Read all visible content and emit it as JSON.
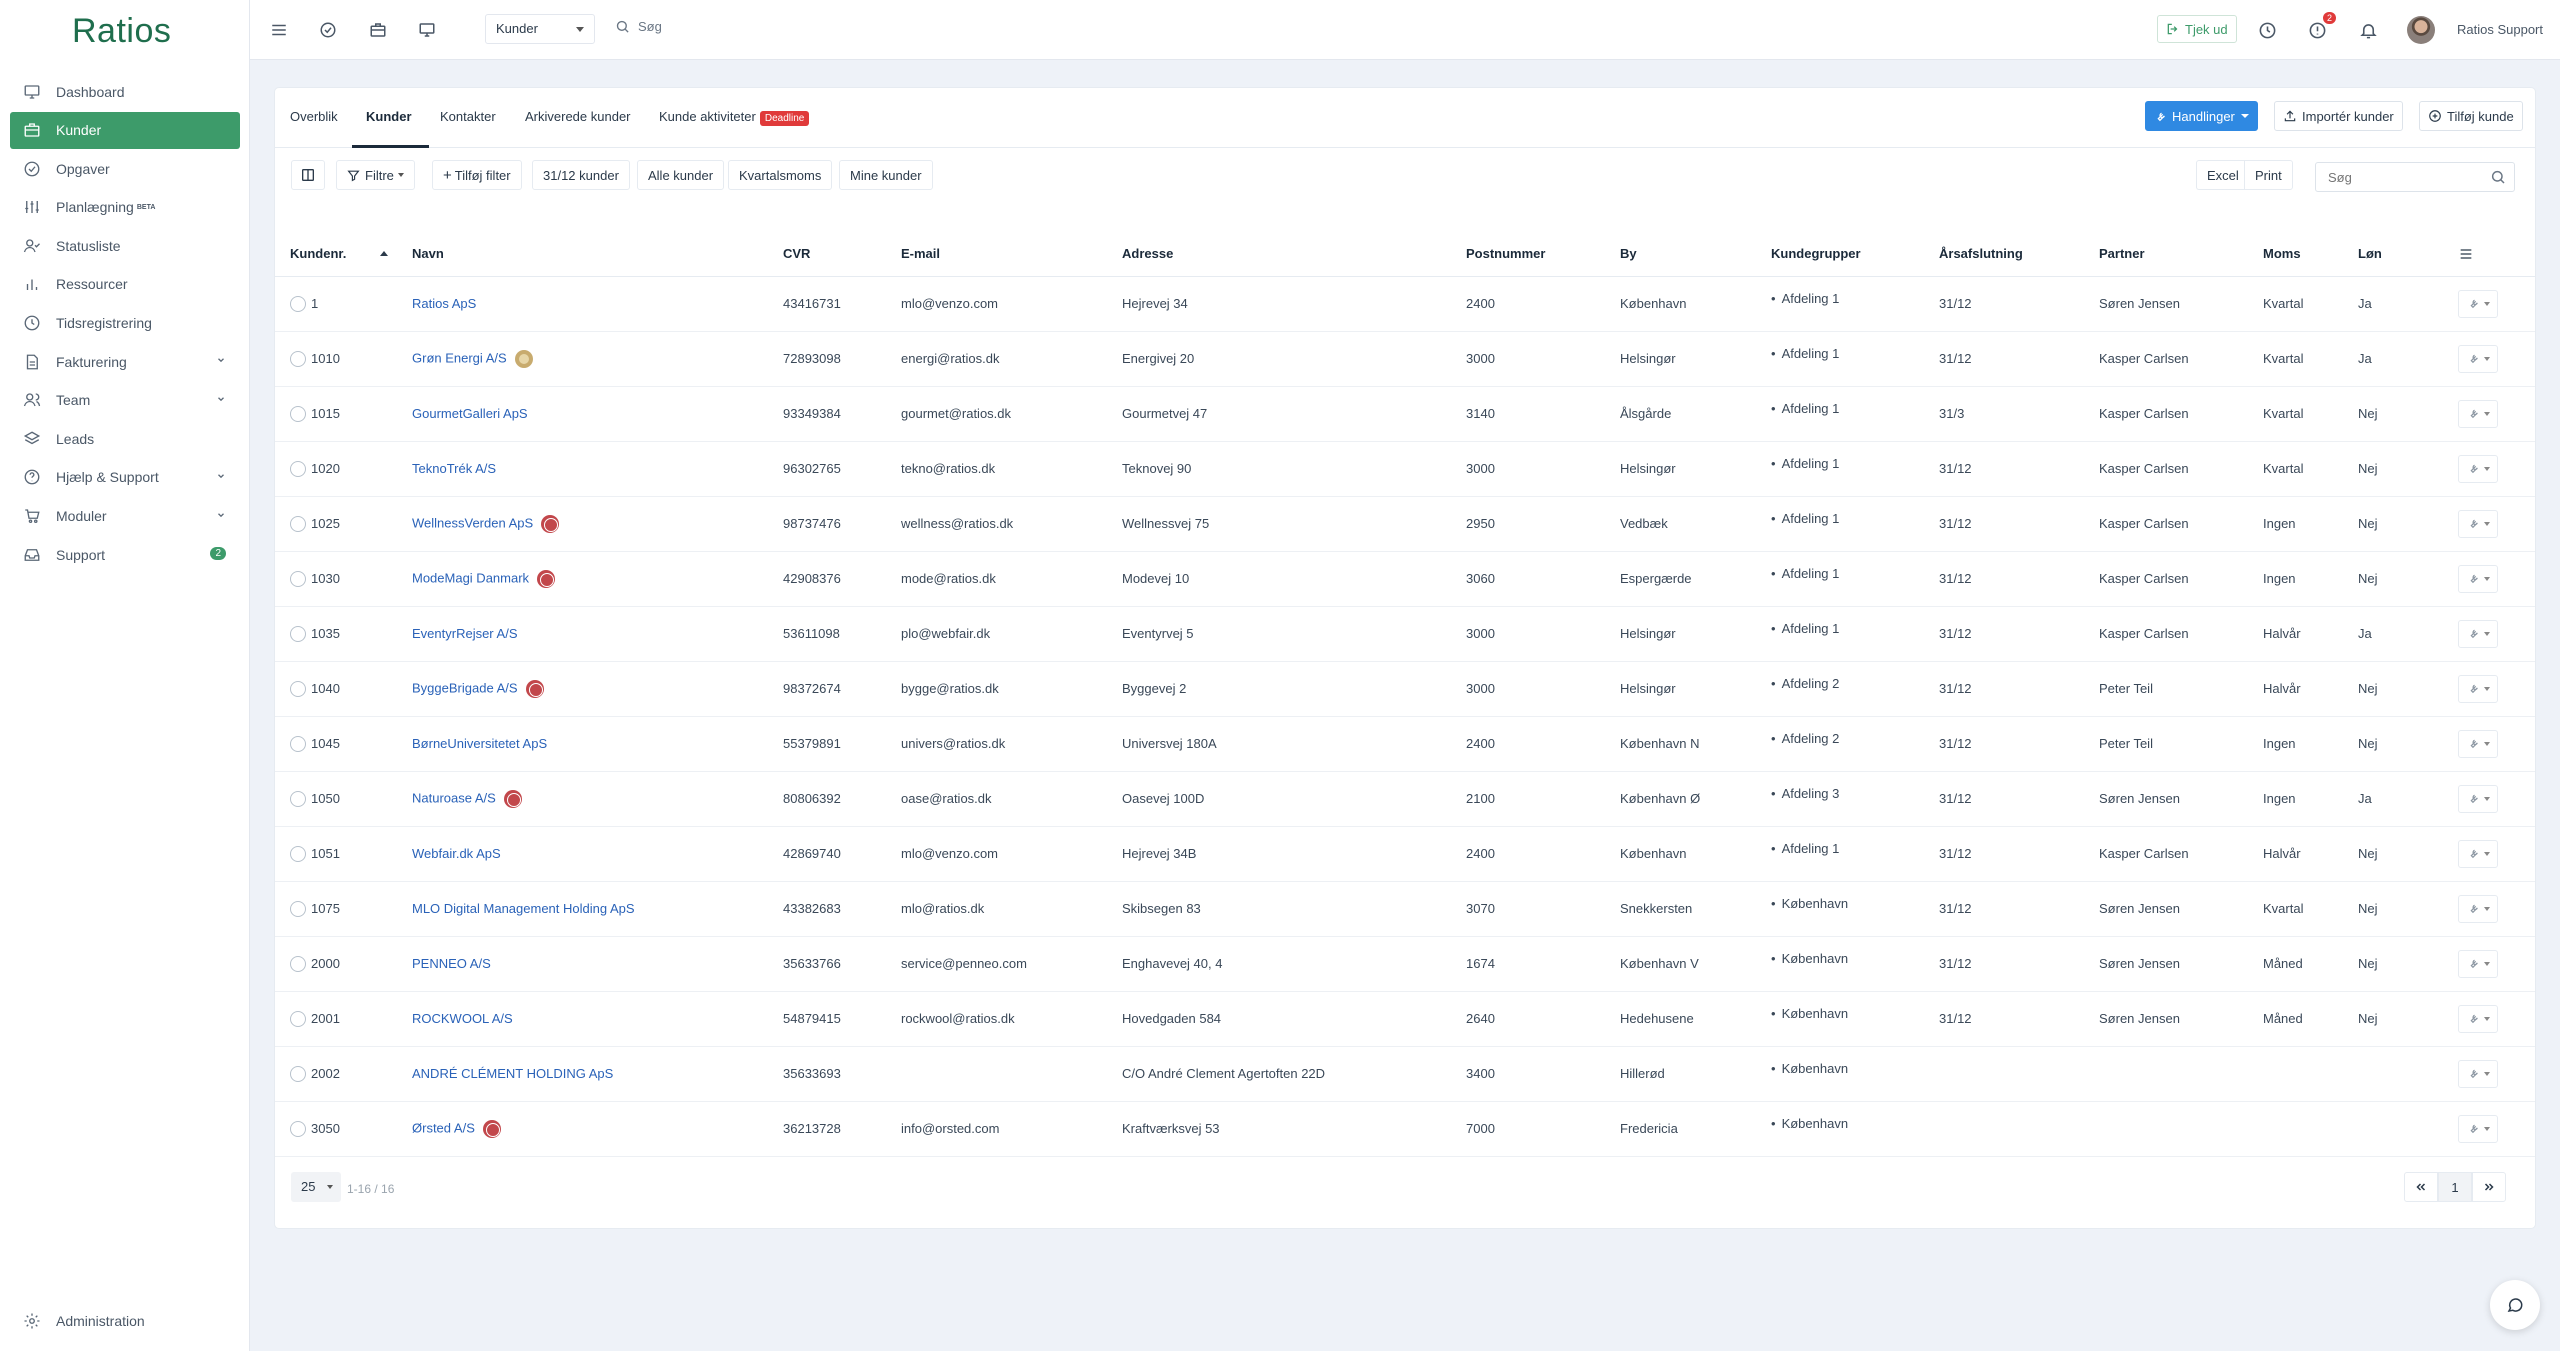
{
  "app": {
    "logo": "Ratios"
  },
  "sidebar": {
    "items": [
      {
        "label": "Dashboard",
        "icon": "monitor-icon"
      },
      {
        "label": "Kunder",
        "icon": "briefcase-icon",
        "active": true
      },
      {
        "label": "Opgaver",
        "icon": "check-circle-icon"
      },
      {
        "label": "Planlægning",
        "icon": "sliders-icon",
        "badge": "BETA"
      },
      {
        "label": "Statusliste",
        "icon": "user-check-icon"
      },
      {
        "label": "Ressourcer",
        "icon": "bar-chart-icon"
      },
      {
        "label": "Tidsregistrering",
        "icon": "clock-icon"
      },
      {
        "label": "Fakturering",
        "icon": "file-text-icon",
        "expandable": true
      },
      {
        "label": "Team",
        "icon": "users-icon",
        "expandable": true
      },
      {
        "label": "Leads",
        "icon": "layers-icon"
      },
      {
        "label": "Hjælp & Support",
        "icon": "help-circle-icon",
        "expandable": true
      },
      {
        "label": "Moduler",
        "icon": "cart-icon",
        "expandable": true
      },
      {
        "label": "Support",
        "icon": "inbox-icon",
        "count": "2"
      }
    ],
    "bottom": {
      "label": "Administration",
      "icon": "gear-icon"
    }
  },
  "topbar": {
    "select_value": "Kunder",
    "search_placeholder": "Søg",
    "tjek_label": "Tjek ud",
    "alert_count": "2",
    "user_name": "Ratios Support"
  },
  "tabs": {
    "overblik": "Overblik",
    "kunder": "Kunder",
    "kontakter": "Kontakter",
    "arkiverede": "Arkiverede kunder",
    "aktiviteter": "Kunde aktiviteter",
    "deadline": "Deadline"
  },
  "actions": {
    "handlinger": "Handlinger",
    "importer": "Importér kunder",
    "tilfoej": "Tilføj kunde"
  },
  "filters": {
    "filtre": "Filtre",
    "tilfoej_filter": "Tilføj filter",
    "f1": "31/12 kunder",
    "f2": "Alle kunder",
    "f3": "Kvartalsmoms",
    "f4": "Mine kunder",
    "excel": "Excel",
    "print": "Print",
    "search_placeholder": "Søg"
  },
  "table": {
    "headers": {
      "nr": "Kundenr.",
      "navn": "Navn",
      "cvr": "CVR",
      "email": "E-mail",
      "adresse": "Adresse",
      "postnr": "Postnummer",
      "by": "By",
      "grupper": "Kundegrupper",
      "aar": "Årsafslutning",
      "partner": "Partner",
      "moms": "Moms",
      "loen": "Løn"
    },
    "rows": [
      {
        "nr": "1",
        "navn": "Ratios ApS",
        "mark": "",
        "cvr": "43416731",
        "email": "mlo@venzo.com",
        "adresse": "Hejrevej 34",
        "postnr": "2400",
        "by": "København",
        "gruppe": "Afdeling 1",
        "aar": "31/12",
        "partner": "Søren Jensen",
        "moms": "Kvartal",
        "loen": "Ja"
      },
      {
        "nr": "1010",
        "navn": "Grøn Energi A/S",
        "mark": "gold",
        "cvr": "72893098",
        "email": "energi@ratios.dk",
        "adresse": "Energivej 20",
        "postnr": "3000",
        "by": "Helsingør",
        "gruppe": "Afdeling 1",
        "aar": "31/12",
        "partner": "Kasper Carlsen",
        "moms": "Kvartal",
        "loen": "Ja"
      },
      {
        "nr": "1015",
        "navn": "GourmetGalleri ApS",
        "mark": "",
        "cvr": "93349384",
        "email": "gourmet@ratios.dk",
        "adresse": "Gourmetvej 47",
        "postnr": "3140",
        "by": "Ålsgårde",
        "gruppe": "Afdeling 1",
        "aar": "31/3",
        "partner": "Kasper Carlsen",
        "moms": "Kvartal",
        "loen": "Nej"
      },
      {
        "nr": "1020",
        "navn": "TeknoTrék A/S",
        "mark": "",
        "cvr": "96302765",
        "email": "tekno@ratios.dk",
        "adresse": "Teknovej 90",
        "postnr": "3000",
        "by": "Helsingør",
        "gruppe": "Afdeling 1",
        "aar": "31/12",
        "partner": "Kasper Carlsen",
        "moms": "Kvartal",
        "loen": "Nej"
      },
      {
        "nr": "1025",
        "navn": "WellnessVerden ApS",
        "mark": "red",
        "cvr": "98737476",
        "email": "wellness@ratios.dk",
        "adresse": "Wellnessvej 75",
        "postnr": "2950",
        "by": "Vedbæk",
        "gruppe": "Afdeling 1",
        "aar": "31/12",
        "partner": "Kasper Carlsen",
        "moms": "Ingen",
        "loen": "Nej"
      },
      {
        "nr": "1030",
        "navn": "ModeMagi Danmark",
        "mark": "red",
        "cvr": "42908376",
        "email": "mode@ratios.dk",
        "adresse": "Modevej 10",
        "postnr": "3060",
        "by": "Espergærde",
        "gruppe": "Afdeling 1",
        "aar": "31/12",
        "partner": "Kasper Carlsen",
        "moms": "Ingen",
        "loen": "Nej"
      },
      {
        "nr": "1035",
        "navn": "EventyrRejser A/S",
        "mark": "",
        "cvr": "53611098",
        "email": "plo@webfair.dk",
        "adresse": "Eventyrvej 5",
        "postnr": "3000",
        "by": "Helsingør",
        "gruppe": "Afdeling 1",
        "aar": "31/12",
        "partner": "Kasper Carlsen",
        "moms": "Halvår",
        "loen": "Ja"
      },
      {
        "nr": "1040",
        "navn": "ByggeBrigade A/S",
        "mark": "red",
        "cvr": "98372674",
        "email": "bygge@ratios.dk",
        "adresse": "Byggevej 2",
        "postnr": "3000",
        "by": "Helsingør",
        "gruppe": "Afdeling 2",
        "aar": "31/12",
        "partner": "Peter Teil",
        "moms": "Halvår",
        "loen": "Nej"
      },
      {
        "nr": "1045",
        "navn": "BørneUniversitetet ApS",
        "mark": "",
        "cvr": "55379891",
        "email": "univers@ratios.dk",
        "adresse": "Universvej 180A",
        "postnr": "2400",
        "by": "København N",
        "gruppe": "Afdeling 2",
        "aar": "31/12",
        "partner": "Peter Teil",
        "moms": "Ingen",
        "loen": "Nej"
      },
      {
        "nr": "1050",
        "navn": "Naturoase A/S",
        "mark": "red",
        "cvr": "80806392",
        "email": "oase@ratios.dk",
        "adresse": "Oasevej 100D",
        "postnr": "2100",
        "by": "København Ø",
        "gruppe": "Afdeling 3",
        "aar": "31/12",
        "partner": "Søren Jensen",
        "moms": "Ingen",
        "loen": "Ja"
      },
      {
        "nr": "1051",
        "navn": "Webfair.dk ApS",
        "mark": "",
        "cvr": "42869740",
        "email": "mlo@venzo.com",
        "adresse": "Hejrevej 34B",
        "postnr": "2400",
        "by": "København",
        "gruppe": "Afdeling 1",
        "aar": "31/12",
        "partner": "Kasper Carlsen",
        "moms": "Halvår",
        "loen": "Nej"
      },
      {
        "nr": "1075",
        "navn": "MLO Digital Management Holding ApS",
        "mark": "",
        "cvr": "43382683",
        "email": "mlo@ratios.dk",
        "adresse": "Skibsegen 83",
        "postnr": "3070",
        "by": "Snekkersten",
        "gruppe": "København",
        "aar": "31/12",
        "partner": "Søren Jensen",
        "moms": "Kvartal",
        "loen": "Nej"
      },
      {
        "nr": "2000",
        "navn": "PENNEO A/S",
        "mark": "",
        "cvr": "35633766",
        "email": "service@penneo.com",
        "adresse": "Enghavevej 40, 4",
        "postnr": "1674",
        "by": "København V",
        "gruppe": "København",
        "aar": "31/12",
        "partner": "Søren Jensen",
        "moms": "Måned",
        "loen": "Nej"
      },
      {
        "nr": "2001",
        "navn": "ROCKWOOL A/S",
        "mark": "",
        "cvr": "54879415",
        "email": "rockwool@ratios.dk",
        "adresse": "Hovedgaden 584",
        "postnr": "2640",
        "by": "Hedehusene",
        "gruppe": "København",
        "aar": "31/12",
        "partner": "Søren Jensen",
        "moms": "Måned",
        "loen": "Nej"
      },
      {
        "nr": "2002",
        "navn": "ANDRÉ CLÉMENT HOLDING ApS",
        "mark": "",
        "cvr": "35633693",
        "email": "",
        "adresse": "C/O André Clement Agertoften 22D",
        "postnr": "3400",
        "by": "Hillerød",
        "gruppe": "København",
        "aar": "",
        "partner": "",
        "moms": "",
        "loen": ""
      },
      {
        "nr": "3050",
        "navn": "Ørsted A/S",
        "mark": "red",
        "cvr": "36213728",
        "email": "info@orsted.com",
        "adresse": "Kraftværksvej 53",
        "postnr": "7000",
        "by": "Fredericia",
        "gruppe": "København",
        "aar": "",
        "partner": "",
        "moms": "",
        "loen": ""
      }
    ]
  },
  "pager": {
    "page_size": "25",
    "info": "1-16 / 16",
    "current": "1"
  }
}
